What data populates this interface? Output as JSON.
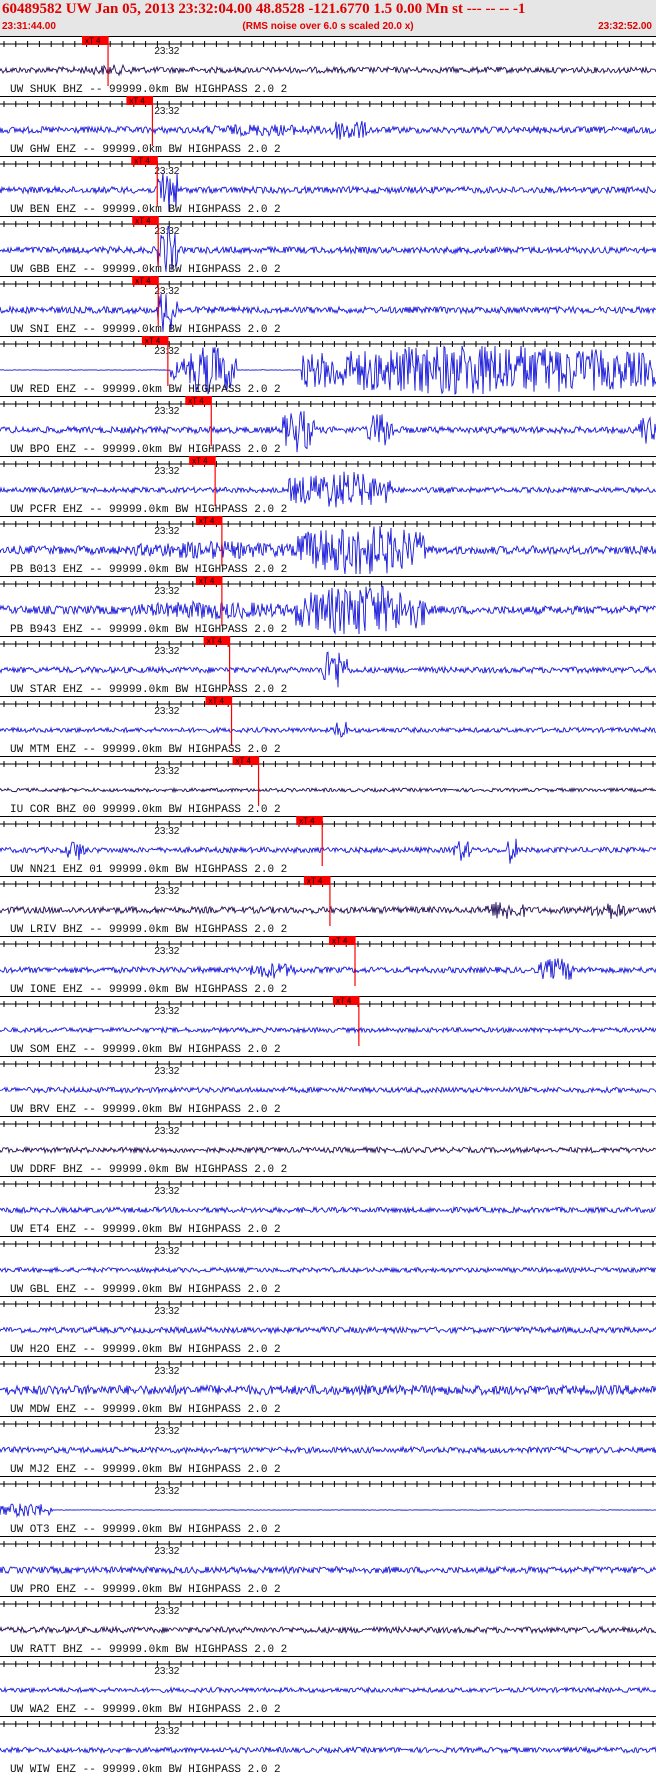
{
  "header": {
    "title": "60489582 UW Jan 05, 2013 23:32:04.00   48.8528 -121.6770  1.5 0.00 Mn st --- -- --  -1",
    "start_time": "23:31:44.00",
    "end_time": "23:32:52.00",
    "subtitle": "(RMS noise over 6.0 s scaled 20.0 x)"
  },
  "colors": {
    "trace": "#1a1adb",
    "trace_dark": "#24105a",
    "pick": "#ff0000",
    "header_bg": "#e6e6e6"
  },
  "chart_data": {
    "type": "line",
    "title": "60489582 UW Jan 05, 2013 23:32:04.00   48.8528 -121.6770  1.5 0.00 Mn st --- -- --  -1",
    "x_range": [
      "23:31:44.00",
      "23:32:52.00"
    ],
    "tick_label": "23:32",
    "tick_label_time": "23:32:00",
    "pick_label": "xT 4",
    "series": [
      {
        "name": "UW SHUK BHZ -- 99999.0km BW  HIGHPASS  2.0  2",
        "pick_time": "23:31:55.2",
        "amplitude": 0.5,
        "dark": true,
        "bursts": [
          [
            0.12,
            0.22,
            0.7
          ]
        ]
      },
      {
        "name": "UW GHW EHZ -- 99999.0km BW  HIGHPASS  2.0  2",
        "pick_time": "23:31:59.8",
        "amplitude": 0.55,
        "dark": false,
        "bursts": [
          [
            0.3,
            0.5,
            0.8
          ],
          [
            0.5,
            0.56,
            1.6
          ]
        ]
      },
      {
        "name": "UW BEN EHZ -- 99999.0km BW  HIGHPASS  2.0  2",
        "pick_time": "23:32:00.3",
        "amplitude": 0.55,
        "dark": false,
        "bursts": [
          [
            0.24,
            0.27,
            3.5
          ]
        ]
      },
      {
        "name": "UW GBB EHZ -- 99999.0km BW  HIGHPASS  2.0  2",
        "pick_time": "23:32:00.4",
        "amplitude": 0.55,
        "dark": false,
        "bursts": [
          [
            0.24,
            0.27,
            3.5
          ]
        ]
      },
      {
        "name": "UW SNI EHZ -- 99999.0km BW  HIGHPASS  2.0  2",
        "pick_time": "23:32:00.4",
        "amplitude": 0.55,
        "dark": false,
        "bursts": [
          [
            0.24,
            0.27,
            3.5
          ]
        ]
      },
      {
        "name": "UW RED EHZ -- 99999.0km BW  HIGHPASS  2.0  2",
        "pick_time": "23:32:01.4",
        "amplitude": 0.05,
        "dark": false,
        "bursts": [
          [
            0.26,
            0.28,
            1.5
          ],
          [
            0.28,
            0.36,
            3.5
          ],
          [
            0.46,
            1.0,
            3.5
          ]
        ]
      },
      {
        "name": "UW BPO EHZ -- 99999.0km BW  HIGHPASS  2.0  2",
        "pick_time": "23:32:05.9",
        "amplitude": 0.55,
        "dark": false,
        "bursts": [
          [
            0.43,
            0.48,
            3.0
          ],
          [
            0.56,
            0.6,
            2.5
          ],
          [
            0.97,
            1.0,
            2.0
          ]
        ]
      },
      {
        "name": "UW PCFR EHZ -- 99999.0km BW  HIGHPASS  2.0  2",
        "pick_time": "23:32:06.3",
        "amplitude": 0.45,
        "dark": false,
        "bursts": [
          [
            0.44,
            0.6,
            2.5
          ]
        ]
      },
      {
        "name": "PB B013 EHZ -- 99999.0km BW  HIGHPASS  2.0  2",
        "pick_time": "23:32:07.0",
        "amplitude": 0.7,
        "dark": false,
        "bursts": [
          [
            0.2,
            0.45,
            1.2
          ],
          [
            0.45,
            0.65,
            3.5
          ]
        ]
      },
      {
        "name": "PB B943 EHZ -- 99999.0km BW  HIGHPASS  2.0  2",
        "pick_time": "23:32:07.0",
        "amplitude": 0.7,
        "dark": false,
        "bursts": [
          [
            0.2,
            0.45,
            1.2
          ],
          [
            0.45,
            0.65,
            3.5
          ]
        ]
      },
      {
        "name": "UW STAR EHZ -- 99999.0km BW  HIGHPASS  2.0  2",
        "pick_time": "23:32:07.8",
        "amplitude": 0.5,
        "dark": false,
        "bursts": [
          [
            0.49,
            0.53,
            3.0
          ]
        ]
      },
      {
        "name": "UW MTM EHZ -- 99999.0km BW  HIGHPASS  2.0  2",
        "pick_time": "23:32:08.0",
        "amplitude": 0.4,
        "dark": false,
        "bursts": [
          [
            0.51,
            0.53,
            1.5
          ]
        ]
      },
      {
        "name": "IU COR BHZ 00 99999.0km BW  HIGHPASS  2.0  2",
        "pick_time": "23:32:10.8",
        "amplitude": 0.3,
        "dark": true,
        "bursts": []
      },
      {
        "name": "UW NN21 EHZ 01 99999.0km BW  HIGHPASS  2.0  2",
        "pick_time": "23:32:17.4",
        "amplitude": 0.45,
        "dark": false,
        "bursts": [
          [
            0.1,
            0.13,
            1.5
          ],
          [
            0.69,
            0.72,
            1.5
          ],
          [
            0.77,
            0.79,
            2.0
          ]
        ]
      },
      {
        "name": "UW LRIV BHZ -- 99999.0km BW  HIGHPASS  2.0  2",
        "pick_time": "23:32:18.2",
        "amplitude": 0.55,
        "dark": true,
        "bursts": [
          [
            0.74,
            0.8,
            1.4
          ],
          [
            0.9,
            0.96,
            1.2
          ]
        ]
      },
      {
        "name": "UW IONE EHZ -- 99999.0km BW  HIGHPASS  2.0  2",
        "pick_time": "23:32:20.8",
        "amplitude": 0.5,
        "dark": false,
        "bursts": [
          [
            0.38,
            0.45,
            1.1
          ],
          [
            0.82,
            0.88,
            1.6
          ]
        ]
      },
      {
        "name": "UW SOM EHZ -- 99999.0km BW  HIGHPASS  2.0  2",
        "pick_time": "23:32:21.2",
        "amplitude": 0.4,
        "dark": false,
        "bursts": []
      },
      {
        "name": "UW BRV EHZ -- 99999.0km BW  HIGHPASS  2.0  2",
        "pick_time": null,
        "amplitude": 0.45,
        "dark": false,
        "bursts": []
      },
      {
        "name": "UW DDRF BHZ -- 99999.0km BW  HIGHPASS  2.0  2",
        "pick_time": null,
        "amplitude": 0.45,
        "dark": true,
        "bursts": []
      },
      {
        "name": "UW ET4 EHZ -- 99999.0km BW  HIGHPASS  2.0  2",
        "pick_time": null,
        "amplitude": 0.45,
        "dark": false,
        "bursts": []
      },
      {
        "name": "UW GBL EHZ -- 99999.0km BW  HIGHPASS  2.0  2",
        "pick_time": null,
        "amplitude": 0.4,
        "dark": false,
        "bursts": []
      },
      {
        "name": "UW H2O EHZ -- 99999.0km BW  HIGHPASS  2.0  2",
        "pick_time": null,
        "amplitude": 0.5,
        "dark": false,
        "bursts": []
      },
      {
        "name": "UW MDW EHZ -- 99999.0km BW  HIGHPASS  2.0  2",
        "pick_time": null,
        "amplitude": 0.8,
        "dark": false,
        "bursts": []
      },
      {
        "name": "UW MJ2 EHZ -- 99999.0km BW  HIGHPASS  2.0  2",
        "pick_time": null,
        "amplitude": 0.5,
        "dark": false,
        "bursts": []
      },
      {
        "name": "UW OT3 EHZ -- 99999.0km BW  HIGHPASS  2.0  2",
        "pick_time": null,
        "amplitude": 0.05,
        "dark": false,
        "bursts": [
          [
            0.0,
            0.08,
            1.0
          ]
        ]
      },
      {
        "name": "UW PRO EHZ -- 99999.0km BW  HIGHPASS  2.0  2",
        "pick_time": null,
        "amplitude": 0.55,
        "dark": false,
        "bursts": []
      },
      {
        "name": "UW RATT BHZ -- 99999.0km BW  HIGHPASS  2.0  2",
        "pick_time": null,
        "amplitude": 0.5,
        "dark": true,
        "bursts": []
      },
      {
        "name": "UW WA2 EHZ -- 99999.0km BW  HIGHPASS  2.0  2",
        "pick_time": null,
        "amplitude": 0.4,
        "dark": false,
        "bursts": []
      },
      {
        "name": "UW WIW EHZ -- 99999.0km BW  HIGHPASS  2.0  2",
        "pick_time": null,
        "amplitude": 0.45,
        "dark": false,
        "bursts": []
      }
    ]
  }
}
